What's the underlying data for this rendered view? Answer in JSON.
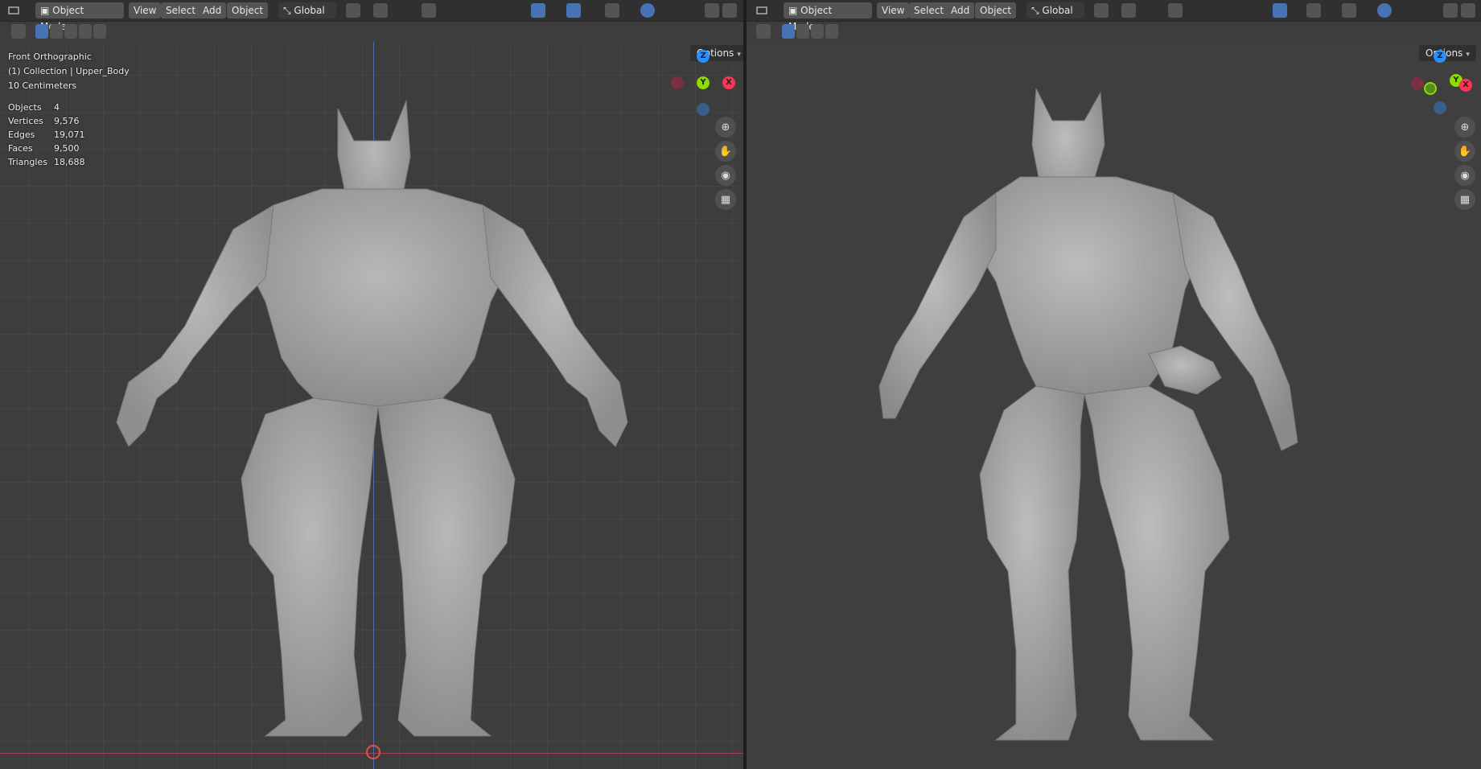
{
  "left_viewport": {
    "header": {
      "mode_label": "Object Mode",
      "menu": [
        "View",
        "Select",
        "Add",
        "Object"
      ],
      "transform_orientation": "Global",
      "options_label": "Options"
    },
    "overlay": {
      "view_name": "Front Orthographic",
      "collection": "(1) Collection | Upper_Body",
      "scale": "10 Centimeters"
    },
    "stats": [
      {
        "label": "Objects",
        "value": "4"
      },
      {
        "label": "Vertices",
        "value": "9,576"
      },
      {
        "label": "Edges",
        "value": "19,071"
      },
      {
        "label": "Faces",
        "value": "9,500"
      },
      {
        "label": "Triangles",
        "value": "18,688"
      }
    ],
    "gizmo": {
      "z": "Z",
      "y": "Y",
      "x": "X"
    }
  },
  "right_viewport": {
    "header": {
      "mode_label": "Object Mode",
      "menu": [
        "View",
        "Select",
        "Add",
        "Object"
      ],
      "transform_orientation": "Global",
      "options_label": "Options"
    },
    "gizmo": {
      "z": "Z",
      "y": "Y",
      "x": "X"
    }
  },
  "colors": {
    "accent": "#4772b3",
    "x_axis": "#ff3352",
    "y_axis": "#8bdc00",
    "z_axis": "#2890ff",
    "bg": "#3d3d3d"
  },
  "icons": [
    "editor-type-icon",
    "object-mode-icon",
    "transform-icon",
    "snap-icon",
    "proportional-icon",
    "visibility-icon",
    "gizmo-icon",
    "overlay-icon",
    "xray-icon",
    "wireframe-icon",
    "solid-icon",
    "material-icon",
    "rendered-icon",
    "zoom-icon",
    "hand-pan-icon",
    "camera-icon",
    "grid-view-icon"
  ]
}
